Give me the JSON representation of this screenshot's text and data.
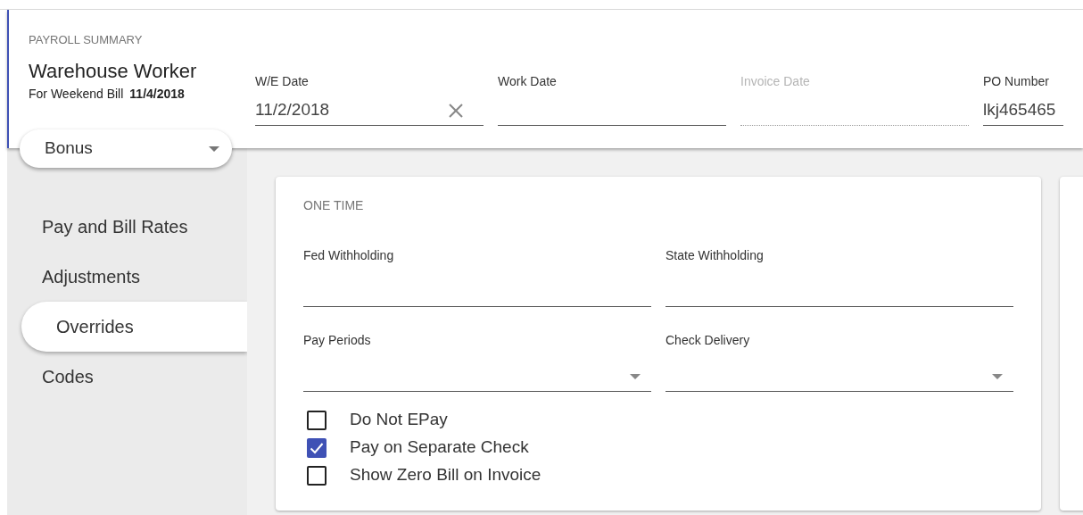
{
  "header": {
    "section_title": "PAYROLL SUMMARY",
    "job_title": "Warehouse Worker",
    "subtitle": "For Weekend Bill",
    "bill_date": "11/4/2018",
    "fields": [
      {
        "kind": "clearable",
        "label": "W/E Date",
        "value": "11/2/2018"
      },
      {
        "kind": "text",
        "label": "Work Date"
      },
      {
        "kind": "disabled",
        "label": "Invoice Date"
      },
      {
        "kind": "text",
        "label": "PO Number",
        "value": "lkj465465"
      }
    ]
  },
  "type_dropdown": {
    "value": "Bonus"
  },
  "sidebar": {
    "items": [
      {
        "label": "Pay and Bill Rates",
        "selected": false
      },
      {
        "label": "Adjustments",
        "selected": false
      },
      {
        "label": "Overrides",
        "selected": true
      },
      {
        "label": "Codes",
        "selected": false
      }
    ]
  },
  "card": {
    "title": "ONE TIME",
    "fields": [
      {
        "kind": "text",
        "label": "Fed Withholding"
      },
      {
        "kind": "text",
        "label": "State Withholding"
      },
      {
        "kind": "select",
        "label": "Pay Periods"
      },
      {
        "kind": "select",
        "label": "Check Delivery"
      }
    ],
    "checkboxes": [
      {
        "label": "Do Not EPay",
        "checked": false
      },
      {
        "label": "Pay on Separate Check",
        "checked": true
      },
      {
        "label": "Show Zero Bill on Invoice",
        "checked": false
      }
    ]
  }
}
